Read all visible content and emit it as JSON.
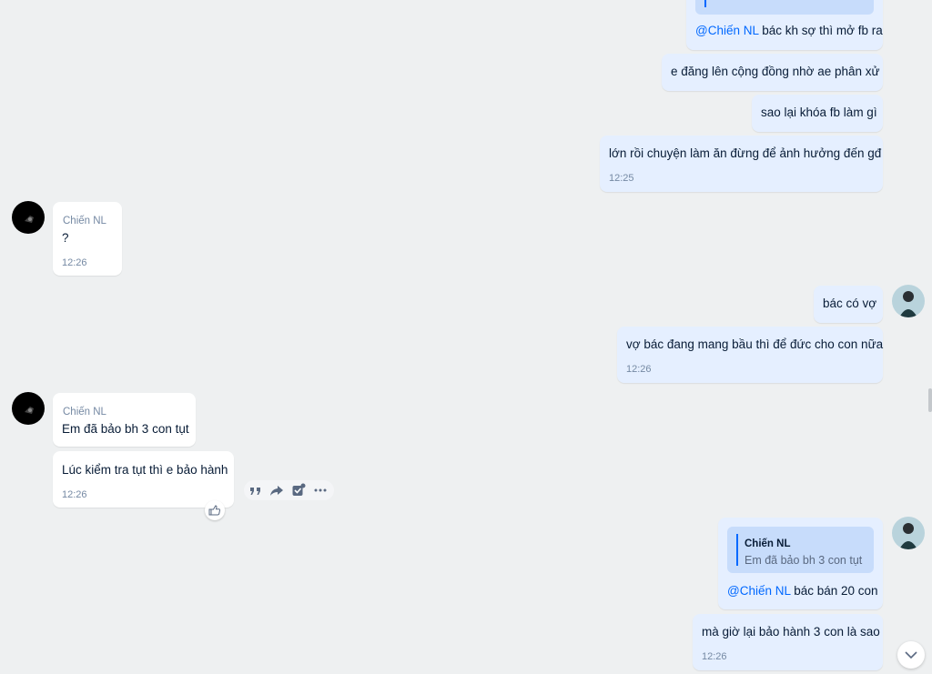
{
  "messages": {
    "top_mention": {
      "mention": "@Chiến NL",
      "text": " bác kh sợ thì mở fb ra"
    },
    "m_dang_len": "e đăng lên cộng đồng nhờ ae phân xử",
    "m_khoa_fb": "sao lại khóa fb làm gì",
    "m_lon_roi": {
      "text": "lớn rồi chuyện làm ăn đừng để ảnh hưởng đến gđ",
      "time": "12:25"
    },
    "in_question": {
      "sender": "Chiến NL",
      "text": "?",
      "time": "12:26"
    },
    "m_bac_co_vo": "bác có vợ",
    "m_vo_bac": {
      "text": "vợ bác đang mang bầu thì để đức cho con nữa",
      "time": "12:26"
    },
    "in_bh": {
      "sender": "Chiến NL",
      "text": "Em đã bảo bh 3 con tụt"
    },
    "in_kiem_tra": {
      "text": "Lúc kiểm tra tụt thì e bảo hành",
      "time": "12:26"
    },
    "reply_quote": {
      "name": "Chiến NL",
      "text": "Em đã bảo bh 3 con tụt",
      "mention": "@Chiến NL",
      "body": " bác bán 20 con"
    },
    "m_ma_gio": {
      "text": "mà giờ lại bảo hành 3 con là sao",
      "time": "12:26"
    }
  },
  "actions": {
    "icons": [
      "quote-icon",
      "forward-icon",
      "mark-task-icon",
      "more-options-icon"
    ]
  },
  "icons": {
    "reaction": "thumbs-up-icon",
    "scroll": "chevron-down-icon"
  },
  "colors": {
    "outgoing_bubble": "#e5efff",
    "incoming_bubble": "#ffffff",
    "mention": "#0068ff",
    "background": "#eef0f1"
  }
}
